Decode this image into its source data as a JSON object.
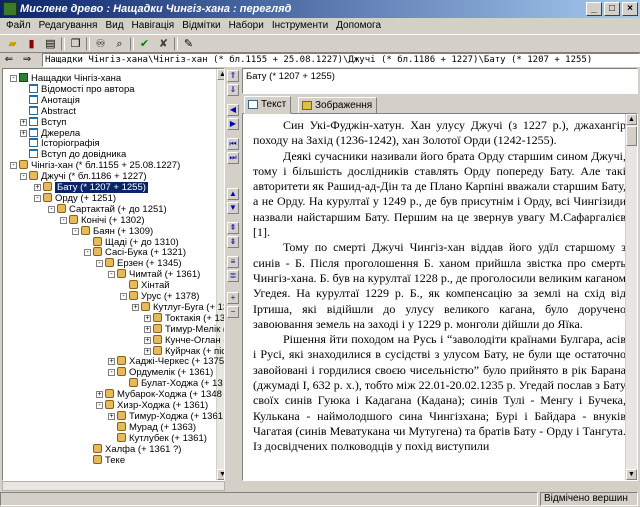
{
  "window": {
    "title": "Мислене древо : Нащадки Чингіз-хана : перегляд"
  },
  "menu": [
    "Файл",
    "Редагування",
    "Вид",
    "Навігація",
    "Відмітки",
    "Набори",
    "Інструменти",
    "Допомога"
  ],
  "path": "Нащадки Чінгіз-хана\\Чінгіз-хан (* бл.1155 + 25.08.1227)\\Джучі (* бл.1186 + 1227)\\Бату (* 1207 + 1255)",
  "title_field": "Бату (* 1207 + 1255)",
  "tabs": {
    "text": "Текст",
    "images": "Зображення"
  },
  "tree": [
    {
      "label": "Нащадки Чінгіз-хана",
      "icon": "book-icon"
    },
    {
      "label": "Відомості про автора",
      "icon": "document-icon"
    },
    {
      "label": "Анотація",
      "icon": "document-icon"
    },
    {
      "label": "Abstract",
      "icon": "document-icon"
    },
    {
      "label": "Вступ",
      "icon": "document-icon"
    },
    {
      "label": "Джерела",
      "icon": "document-icon"
    },
    {
      "label": "Історіографія",
      "icon": "document-icon"
    },
    {
      "label": "Вступ до довідника",
      "icon": "document-icon"
    },
    {
      "label": "Чінгіз-хан (* бл.1155 + 25.08.1227)",
      "icon": "person-icon"
    },
    {
      "label": "Джучі (* бл.1186 + 1227)",
      "icon": "person-icon"
    },
    {
      "label": "Бату (* 1207 + 1255)",
      "icon": "person-icon"
    },
    {
      "label": "Орду (+ 1251)",
      "icon": "person-icon"
    },
    {
      "label": "Сартактай (+ до 1251)",
      "icon": "person-icon"
    },
    {
      "label": "Конічі (+ 1302)",
      "icon": "person-icon"
    },
    {
      "label": "Баян (+ 1309)",
      "icon": "person-icon"
    },
    {
      "label": "Щаді (+ до 1310)",
      "icon": "person-icon"
    },
    {
      "label": "Сасі-Бука (+ 1321)",
      "icon": "person-icon"
    },
    {
      "label": "Ерзен (+ 1345)",
      "icon": "person-icon"
    },
    {
      "label": "Чимтай (+ 1361)",
      "icon": "person-icon"
    },
    {
      "label": "Хінтай",
      "icon": "person-icon"
    },
    {
      "label": "Урус (+ 1378)",
      "icon": "person-icon"
    },
    {
      "label": "Кутлуг-Буга (+ 1361)",
      "icon": "person-icon"
    },
    {
      "label": "Токтакія (+ 1378",
      "icon": "person-icon"
    },
    {
      "label": "Тимур-Мелік (+",
      "icon": "person-icon"
    },
    {
      "label": "Кунче-Оглан (+",
      "icon": "person-icon"
    },
    {
      "label": "Куйрчак (+ післ",
      "icon": "person-icon"
    },
    {
      "label": "Хаджі-Черкес (+ 1375",
      "icon": "person-icon"
    },
    {
      "label": "Ордумелік (+ 1361)",
      "icon": "person-icon"
    },
    {
      "label": "Булат-Ходжа (+ 13",
      "icon": "person-icon"
    },
    {
      "label": "Мубарок-Ходжа (+ 1348",
      "icon": "person-icon"
    },
    {
      "label": "Хизр-Ходжа (+ 1361)",
      "icon": "person-icon"
    },
    {
      "label": "Тимур-Ходжа (+ 1361",
      "icon": "person-icon"
    },
    {
      "label": "Мурад (+ 1363)",
      "icon": "person-icon"
    },
    {
      "label": "Кутлубек (+ 1361)",
      "icon": "person-icon"
    },
    {
      "label": "Халфа (+ 1361 ?)",
      "icon": "person-icon"
    },
    {
      "label": "Теке",
      "icon": "person-icon"
    }
  ],
  "text": [
    "Син Укі-Фуджін-хатун. Хан улусу Джучі (з 1227 р.), джахангір походу на Захід (1236-1242), хан Золотої Орди (1242-1255).",
    "Деякі сучасники називали його брата Орду старшим сином Джучі, тому і більшість дослідників ставлять Орду попереду Бату. Але такі авторитети як Рашид-ад-Дін та де Плано Карпіні вважали старшим Бату, а не Орду. На курултаї у 1249 р., де був присутнім і Орду, всі Чингізиди назвали найстаршим Бату. Першим на це звернув увагу М.Сафаргалієв [1].",
    "Тому по смерті Джучі Чингіз-хан віддав його удїл старшому з синів - Б. Після проголошення Б. ханом прийшла звістка про смерть Чингіз-хана. Б. був на курултаї 1228 р., де проголосили великим каганом Угедея. На курултаї 1229 р. Б., як компенсацію за землі на схід від Іртиша, які відійшли до улусу великого кагана, було доручено завоювання земель на заході і у 1229 р. монголи дійшли до Яїка.",
    "Рішення йти походом на Русь і “заволодіти країнами Булгара, асів і Русі, які знаходилися в сусідстві з улусом Бату, не були ще остаточно завойовані і гордилися своєю чисельністю” було прийнято в рік Барана (джумаді I, 632 р. х.), тобто між 22.01-20.02.1235 р. Угедай послав з Бату своїх синів Гуюка і Кадагана (Кадана); синів Тулі - Менгу і Бучека, Кулькана - наймолодшого сина Чингізхана; Бурі і Байдара - внуків Чагатая (синів Меватукана чи Мутугена) та братів Бату - Орду і Тангута. Із досвідчених полководців у похід виступили"
  ],
  "status": {
    "left": "",
    "right": "Відмічено вершин"
  }
}
